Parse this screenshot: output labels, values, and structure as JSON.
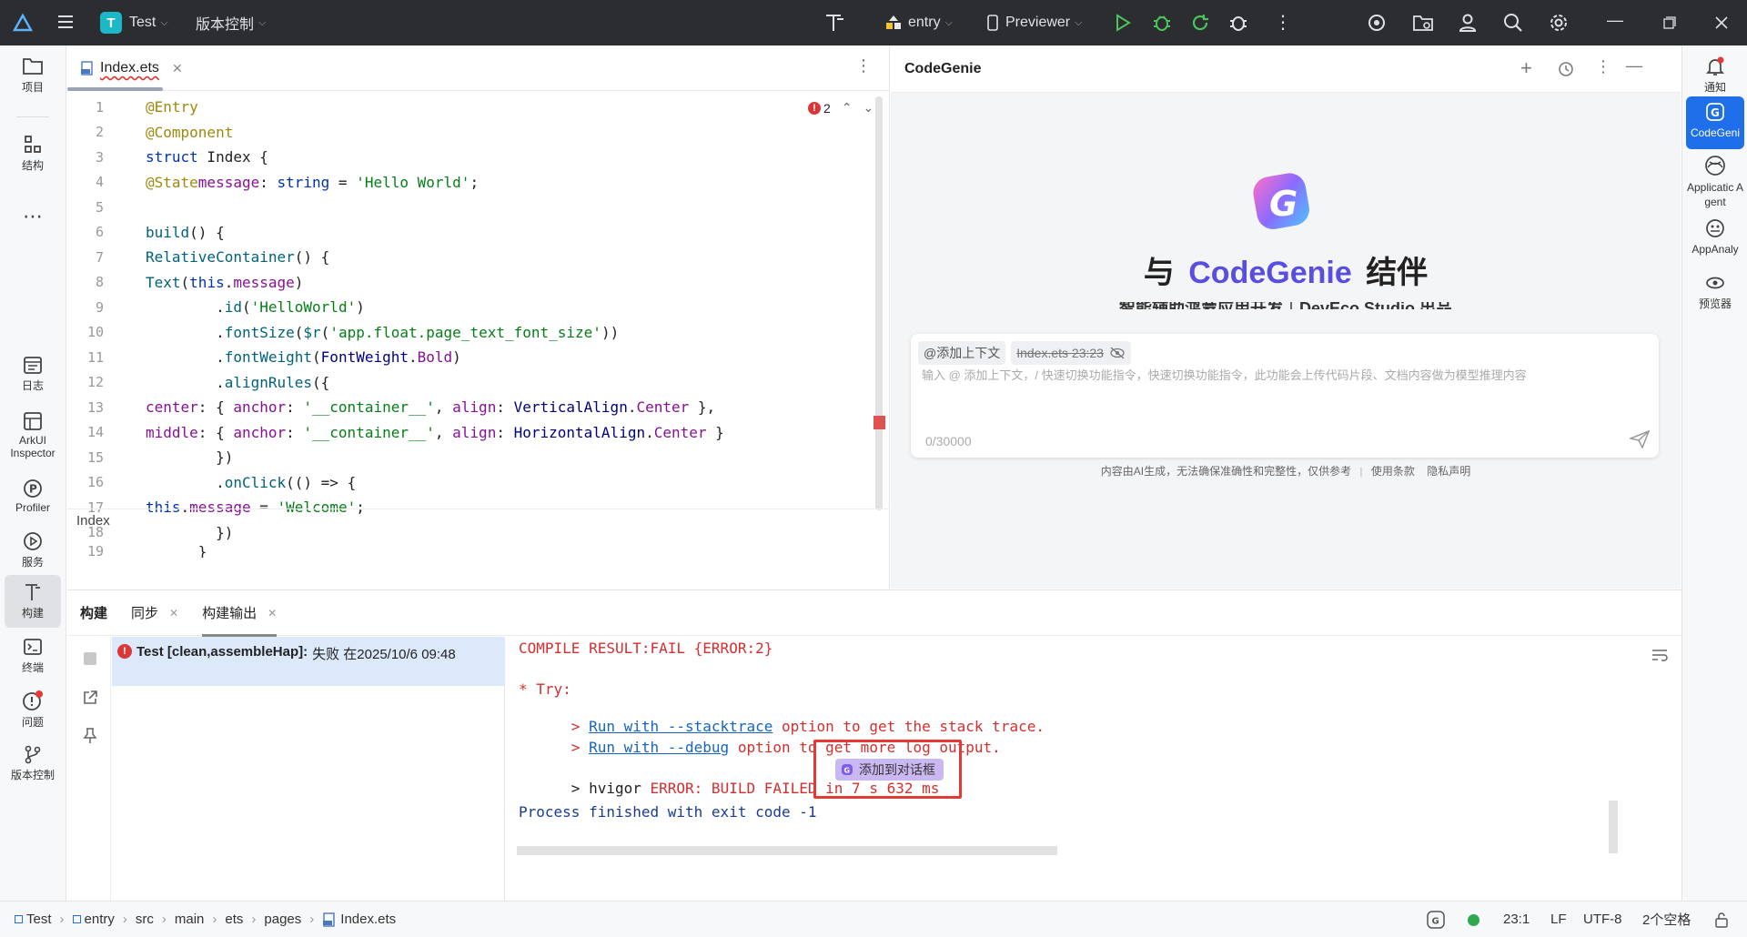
{
  "topbar": {
    "project_letter": "T",
    "project_name": "Test",
    "vcs_label": "版本控制",
    "run_config": "entry",
    "device": "Previewer"
  },
  "left_sidebar": {
    "items": [
      {
        "label": "项目"
      },
      {
        "label": "结构"
      },
      {
        "label": "日志"
      },
      {
        "label": "ArkUI Inspector"
      },
      {
        "label": "Profiler"
      },
      {
        "label": "服务"
      },
      {
        "label": "构建"
      },
      {
        "label": "终端"
      },
      {
        "label": "问题"
      },
      {
        "label": "版本控制"
      }
    ]
  },
  "right_sidebar": {
    "items": [
      {
        "label": "通知"
      },
      {
        "label": "CodeGeni"
      },
      {
        "label": "Applicatic Agent"
      },
      {
        "label": "AppAnaly"
      },
      {
        "label": "预览器"
      }
    ]
  },
  "editor": {
    "tab_name": "Index.ets",
    "error_count": "2",
    "breadcrumb": "Index",
    "line_numbers": [
      "1",
      "2",
      "3",
      "4",
      "5",
      "6",
      "7",
      "8",
      "9",
      "10",
      "11",
      "12",
      "13",
      "14",
      "15",
      "16",
      "17",
      "18",
      "19"
    ]
  },
  "codegenie": {
    "title": "CodeGenie",
    "hero_prefix": "与",
    "hero_brand": "CodeGenie",
    "hero_suffix": "结伴",
    "tagline_partial": "智能辅助鸿蒙应用开发｜DevEco Studio 出品",
    "context_chip": "@添加上下文",
    "file_chip": "Index.ets 23:23",
    "input_placeholder": "输入 @ 添加上下文，/ 快速切换功能指令，快速切换功能指令，此功能会上传代码片段、文档内容做为模型推理内容",
    "counter": "0/30000",
    "disclaimer": "内容由AI生成，无法确保准确性和完整性，仅供参考",
    "terms": "使用条款",
    "privacy": "隐私声明"
  },
  "bottom_panel": {
    "tabs": [
      {
        "label": "构建"
      },
      {
        "label": "同步"
      },
      {
        "label": "构建输出"
      }
    ],
    "task_name": "Test [clean,assembleHap]:",
    "task_status": "失败 在2025/10/6 09:48",
    "console": {
      "line1": "COMPILE RESULT:FAIL {ERROR:2}",
      "line2": "* Try:",
      "line3_prefix": "> ",
      "line3_link": "Run with --stacktrace",
      "line3_rest": " option to get the stack trace.",
      "line4_prefix": "> ",
      "line4_link": "Run with --debug",
      "line4_rest": " option to get more log output.",
      "line5_prefix": "> hvigor ",
      "line5_error": "ERROR: BUILD FAILED in 7 s 632 ms",
      "add_to_chat": "添加到对话框",
      "line6": "Process finished with exit code -1"
    }
  },
  "statusbar": {
    "path": [
      "Test",
      "entry",
      "src",
      "main",
      "ets",
      "pages",
      "Index.ets"
    ],
    "position": "23:1",
    "line_sep": "LF",
    "encoding": "UTF-8",
    "indent": "2个空格"
  },
  "colors": {
    "topbar_bg": "#2b2d30",
    "accent": "#1f6feb",
    "error": "#d32f2f",
    "highlight_box": "#e53935"
  }
}
